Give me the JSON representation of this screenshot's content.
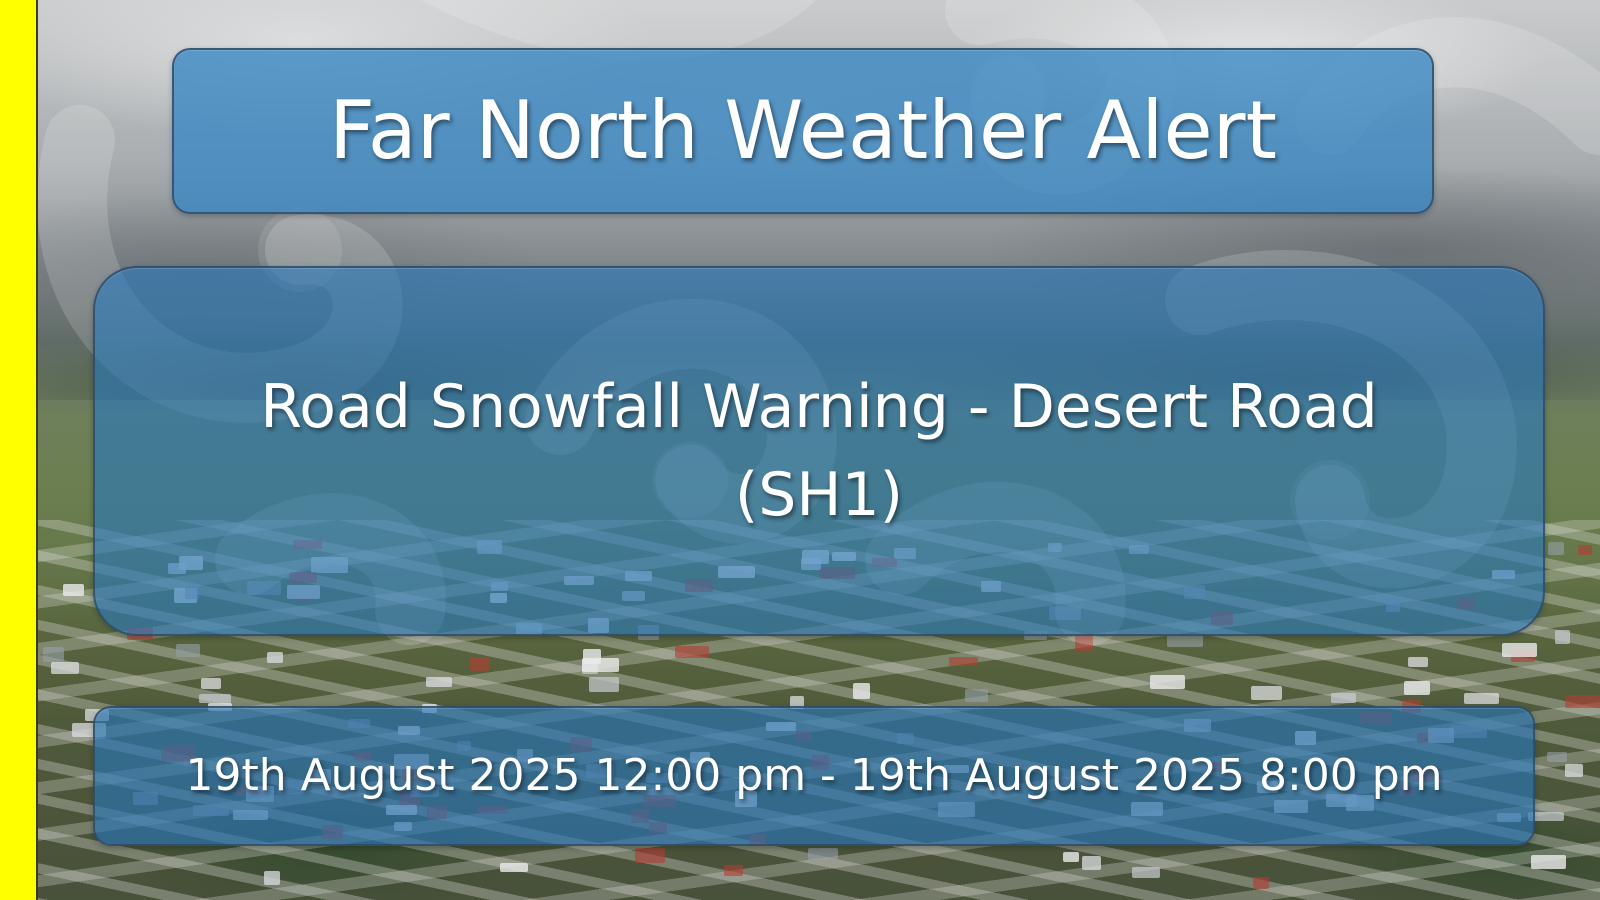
{
  "alert": {
    "header_title": "Far North Weather Alert",
    "warning_title": "Road Snowfall Warning - Desert Road (SH1)",
    "time_range": "19th August 2025 12:00 pm - 19th August 2025 8:00 pm"
  },
  "colors": {
    "edge_bar": "#ffff00",
    "panel_blue": "#2878b9",
    "text": "#ffffff"
  },
  "icons": {
    "watermark": "koru-swirl-pattern"
  }
}
